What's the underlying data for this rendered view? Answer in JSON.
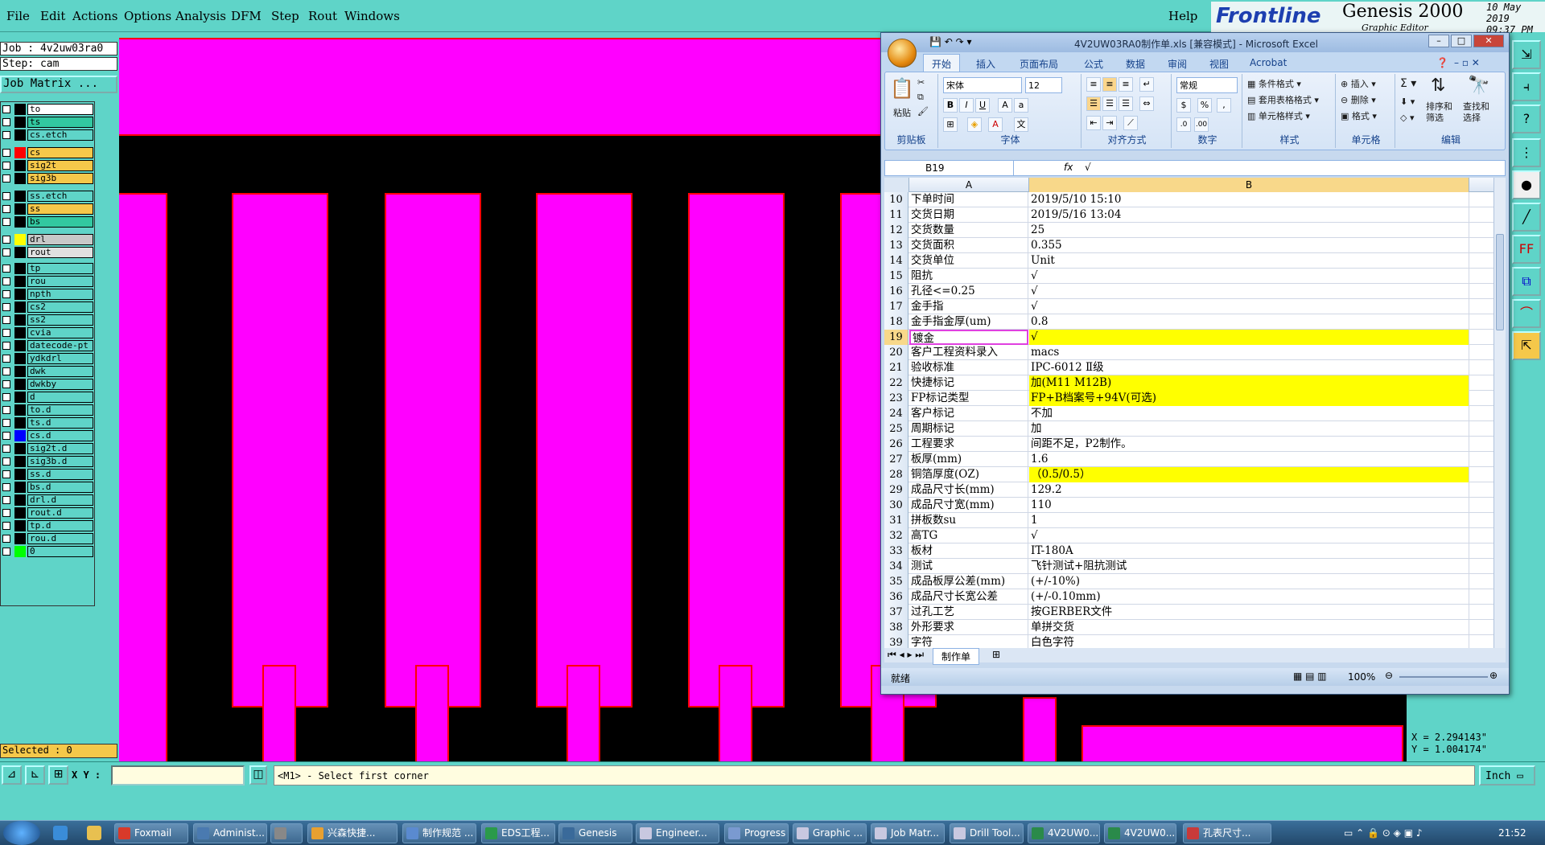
{
  "menubar": {
    "items": [
      "File",
      "Edit",
      "Actions",
      "Options",
      "Analysis",
      "DFM",
      "Step",
      "Rout",
      "Windows"
    ],
    "help": "Help",
    "brand_logo": "Frontline",
    "brand_product": "Genesis 2000",
    "brand_date": "10 May 2019",
    "brand_time": "09:37 PM",
    "brand_sub": "Graphic Editor"
  },
  "job": {
    "job_label": "Job : 4v2uw03ra0",
    "step_label": "Step: cam",
    "matrix_button": "Job Matrix ...",
    "selected": "Selected : 0"
  },
  "layers": [
    {
      "name": "to",
      "color": "#000000",
      "bg": "#ffffff"
    },
    {
      "name": "ts",
      "color": "#000000",
      "bg": "#32c8a0"
    },
    {
      "name": "cs.etch",
      "color": "#000000",
      "bg": "#5fd4c8"
    },
    {
      "name": "cs",
      "color": "#ff0000",
      "bg": "#f5c84a"
    },
    {
      "name": "sig2t",
      "color": "#000000",
      "bg": "#f5c84a"
    },
    {
      "name": "sig3b",
      "color": "#000000",
      "bg": "#f5c84a"
    },
    {
      "name": "ss.etch",
      "color": "#000000",
      "bg": "#5fd4c8"
    },
    {
      "name": "ss",
      "color": "#000000",
      "bg": "#f5c84a"
    },
    {
      "name": "bs",
      "color": "#000000",
      "bg": "#32c8a0"
    },
    {
      "name": "drl",
      "color": "#ffff00",
      "bg": "#c8c8c8"
    },
    {
      "name": "rout",
      "color": "#000000",
      "bg": "#e0e0e0"
    },
    {
      "name": "tp",
      "color": "#000000",
      "bg": "#5fd4c8"
    },
    {
      "name": "rou",
      "color": "#000000",
      "bg": "#5fd4c8"
    },
    {
      "name": "npth",
      "color": "#000000",
      "bg": "#5fd4c8"
    },
    {
      "name": "cs2",
      "color": "#000000",
      "bg": "#5fd4c8"
    },
    {
      "name": "ss2",
      "color": "#000000",
      "bg": "#5fd4c8"
    },
    {
      "name": "cvia",
      "color": "#000000",
      "bg": "#5fd4c8"
    },
    {
      "name": "datecode-pt",
      "color": "#000000",
      "bg": "#5fd4c8"
    },
    {
      "name": "ydkdrl",
      "color": "#000000",
      "bg": "#5fd4c8"
    },
    {
      "name": "dwk",
      "color": "#000000",
      "bg": "#5fd4c8"
    },
    {
      "name": "dwkby",
      "color": "#000000",
      "bg": "#5fd4c8"
    },
    {
      "name": "d",
      "color": "#000000",
      "bg": "#5fd4c8"
    },
    {
      "name": "to.d",
      "color": "#000000",
      "bg": "#5fd4c8"
    },
    {
      "name": "ts.d",
      "color": "#000000",
      "bg": "#5fd4c8"
    },
    {
      "name": "cs.d",
      "color": "#0000ff",
      "bg": "#5fd4c8"
    },
    {
      "name": "sig2t.d",
      "color": "#000000",
      "bg": "#5fd4c8"
    },
    {
      "name": "sig3b.d",
      "color": "#000000",
      "bg": "#5fd4c8"
    },
    {
      "name": "ss.d",
      "color": "#000000",
      "bg": "#5fd4c8"
    },
    {
      "name": "bs.d",
      "color": "#000000",
      "bg": "#5fd4c8"
    },
    {
      "name": "drl.d",
      "color": "#000000",
      "bg": "#5fd4c8"
    },
    {
      "name": "rout.d",
      "color": "#000000",
      "bg": "#5fd4c8"
    },
    {
      "name": "tp.d",
      "color": "#000000",
      "bg": "#5fd4c8"
    },
    {
      "name": "rou.d",
      "color": "#000000",
      "bg": "#5fd4c8"
    },
    {
      "name": "0",
      "color": "#00ff00",
      "bg": "#5fd4c8"
    }
  ],
  "command": {
    "xy_label": "X Y :",
    "xy_value": "",
    "prompt": "<M1> - Select first corner",
    "units": "Inch"
  },
  "coords": {
    "x": "X = 2.294143\"",
    "y": "Y = 1.004174\""
  },
  "excel": {
    "title": "4V2UW03RA0制作单.xls  [兼容模式] - Microsoft Excel",
    "tabs": [
      "开始",
      "插入",
      "页面布局",
      "公式",
      "数据",
      "审阅",
      "视图",
      "Acrobat"
    ],
    "groups": {
      "clipboard": "剪贴板",
      "paste": "粘贴",
      "font": "字体",
      "font_name": "宋体",
      "font_size": "12",
      "align": "对齐方式",
      "number": "数字",
      "number_format": "常规",
      "style": "样式",
      "cond_format": "条件格式",
      "table_format": "套用表格格式",
      "cell_style": "单元格样式",
      "cells": "单元格",
      "insert": "插入",
      "delete": "删除",
      "format": "格式",
      "edit": "编辑",
      "sort": "排序和筛选",
      "find": "查找和选择"
    },
    "namebox": "B19",
    "formula": "√",
    "col_a": "A",
    "col_b": "B",
    "rows": [
      {
        "n": "10",
        "a": "下单时间",
        "b": "2019/5/10 15:10"
      },
      {
        "n": "11",
        "a": "交货日期",
        "b": "2019/5/16 13:04"
      },
      {
        "n": "12",
        "a": "交货数量",
        "b": "25"
      },
      {
        "n": "13",
        "a": "交货面积",
        "b": "0.355"
      },
      {
        "n": "14",
        "a": "交货单位",
        "b": "Unit"
      },
      {
        "n": "15",
        "a": "阻抗",
        "b": "√"
      },
      {
        "n": "16",
        "a": "孔径<=0.25",
        "b": "√"
      },
      {
        "n": "17",
        "a": "金手指",
        "b": "√"
      },
      {
        "n": "18",
        "a": "金手指金厚(um)",
        "b": "0.8"
      },
      {
        "n": "19",
        "a": "镀金",
        "b": "√"
      },
      {
        "n": "20",
        "a": "客户工程资料录入",
        "b": "macs"
      },
      {
        "n": "21",
        "a": "验收标准",
        "b": "IPC-6012 Ⅱ级"
      },
      {
        "n": "22",
        "a": "快捷标记",
        "b": "加(M11 M12B)"
      },
      {
        "n": "23",
        "a": "FP标记类型",
        "b": "FP+B档案号+94V(可选)"
      },
      {
        "n": "24",
        "a": "客户标记",
        "b": "不加"
      },
      {
        "n": "25",
        "a": "周期标记",
        "b": "加"
      },
      {
        "n": "26",
        "a": "工程要求",
        "b": "间距不足，P2制作。"
      },
      {
        "n": "27",
        "a": "板厚(mm)",
        "b": "1.6"
      },
      {
        "n": "28",
        "a": "铜箔厚度(OZ)",
        "b": "（0.5/0.5）"
      },
      {
        "n": "29",
        "a": "成品尺寸长(mm)",
        "b": "129.2"
      },
      {
        "n": "30",
        "a": "成品尺寸宽(mm)",
        "b": "110"
      },
      {
        "n": "31",
        "a": "拼板数su",
        "b": "1"
      },
      {
        "n": "32",
        "a": "高TG",
        "b": "√"
      },
      {
        "n": "33",
        "a": "板材",
        "b": "IT-180A"
      },
      {
        "n": "34",
        "a": "测试",
        "b": "飞针测试+阻抗测试"
      },
      {
        "n": "35",
        "a": "成品板厚公差(mm)",
        "b": "(+/-10%)"
      },
      {
        "n": "36",
        "a": "成品尺寸长宽公差",
        "b": "(+/-0.10mm)"
      },
      {
        "n": "37",
        "a": "过孔工艺",
        "b": "按GERBER文件"
      },
      {
        "n": "38",
        "a": "外形要求",
        "b": "单拼交货"
      },
      {
        "n": "39",
        "a": "字符",
        "b": "白色字符"
      }
    ],
    "highlight_rows": [
      "19",
      "22",
      "23",
      "28"
    ],
    "sheet_tab": "制作单",
    "status": "就绪",
    "zoom": "100%"
  },
  "taskbar": {
    "items": [
      "Foxmail",
      "Administ...",
      "",
      "兴森快捷...",
      "制作规范 ...",
      "EDS工程...",
      "Genesis",
      "Engineer...",
      "Progress",
      "Graphic ...",
      "Job Matr...",
      "Drill Tool...",
      "4V2UW0...",
      "4V2UW0...",
      "孔表尺寸..."
    ],
    "clock": "21:52"
  },
  "colors": {
    "copper": "#ff00ff",
    "outline": "#ff0000",
    "bg_app": "#5fd4c8",
    "highlight": "#ffff00"
  }
}
